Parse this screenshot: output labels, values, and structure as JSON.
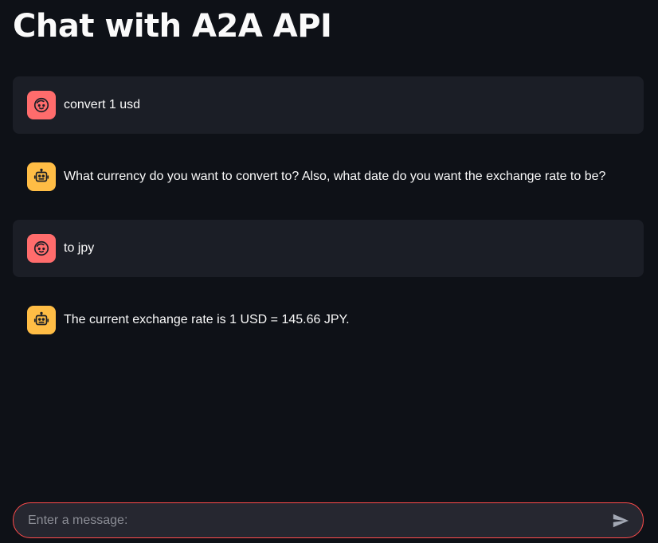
{
  "page": {
    "title": "Chat with A2A API"
  },
  "messages": [
    {
      "role": "user",
      "avatar_icon": "user-face-icon",
      "text": "convert 1 usd"
    },
    {
      "role": "assistant",
      "avatar_icon": "robot-icon",
      "text": "What currency do you want to convert to? Also, what date do you want the exchange rate to be?"
    },
    {
      "role": "user",
      "avatar_icon": "user-face-icon",
      "text": "to jpy"
    },
    {
      "role": "assistant",
      "avatar_icon": "robot-icon",
      "text": "The current exchange rate is 1 USD = 145.66 JPY."
    }
  ],
  "chat_input": {
    "placeholder": "Enter a message:",
    "value": "",
    "send_icon": "send-icon"
  },
  "colors": {
    "background": "#0e1117",
    "user_bubble": "#1b1e26",
    "user_avatar": "#ff6c6c",
    "assistant_avatar": "#ffbd45",
    "input_border": "#ff4b4b"
  }
}
